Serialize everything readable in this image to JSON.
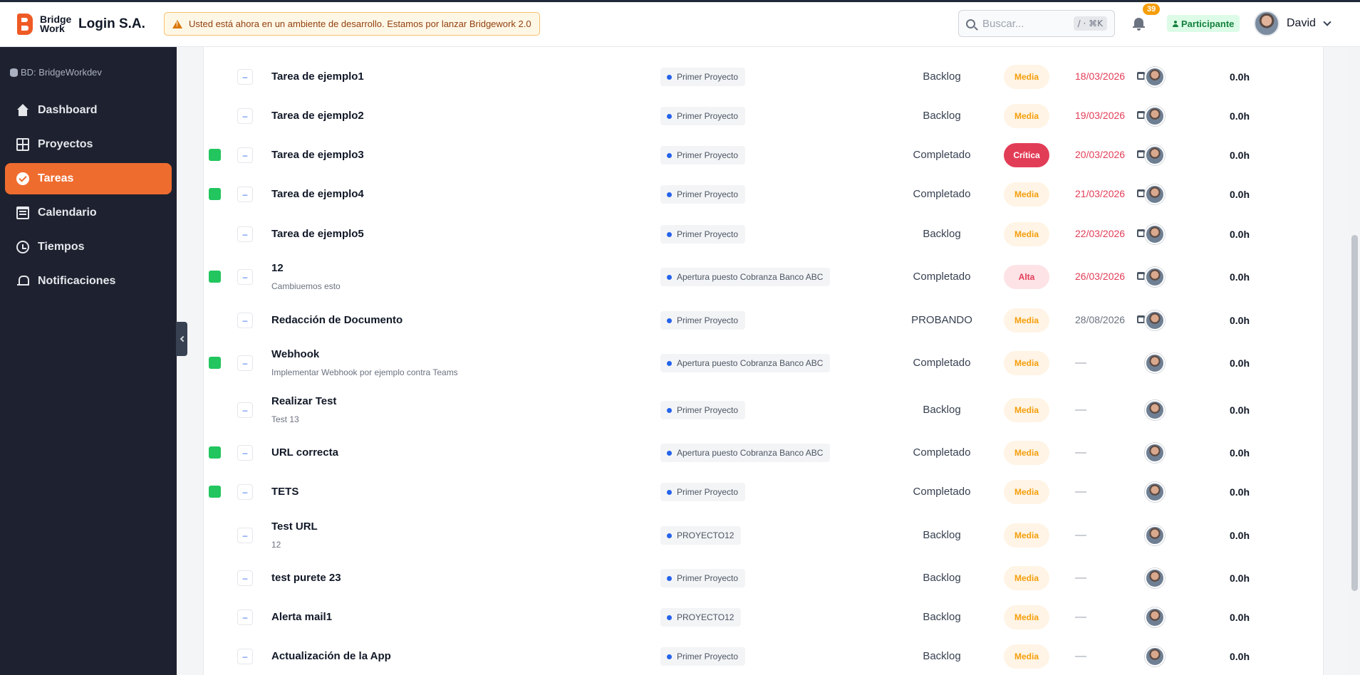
{
  "header": {
    "logo_text": "Bridge Work",
    "company": "Login S.A.",
    "dev_banner": "Usted está ahora en un ambiente de desarrollo. Estamos por lanzar Bridgework 2.0",
    "search_placeholder": "Buscar...",
    "search_shortcut": "/ · ⌘K",
    "notifications_count": "39",
    "role": "Participante",
    "user_name": "David"
  },
  "sidebar": {
    "db_label": "BD: BridgeWorkdev",
    "items": [
      {
        "label": "Dashboard",
        "icon": "home-icon"
      },
      {
        "label": "Proyectos",
        "icon": "grid-icon"
      },
      {
        "label": "Tareas",
        "icon": "check-circle-icon",
        "active": true
      },
      {
        "label": "Calendario",
        "icon": "calendar-icon"
      },
      {
        "label": "Tiempos",
        "icon": "clock-icon"
      },
      {
        "label": "Notificaciones",
        "icon": "bell-icon"
      }
    ]
  },
  "tasks": [
    {
      "title": "Tarea de ejemplo1",
      "subtitle": "",
      "project": "Primer Proyecto",
      "status": "Backlog",
      "priority": "Media",
      "date": "18/03/2026",
      "hours": "0.0h",
      "done": false
    },
    {
      "title": "Tarea de ejemplo2",
      "subtitle": "",
      "project": "Primer Proyecto",
      "status": "Backlog",
      "priority": "Media",
      "date": "19/03/2026",
      "hours": "0.0h",
      "done": false
    },
    {
      "title": "Tarea de ejemplo3",
      "subtitle": "",
      "project": "Primer Proyecto",
      "status": "Completado",
      "priority": "Crítica",
      "date": "20/03/2026",
      "hours": "0.0h",
      "done": true
    },
    {
      "title": "Tarea de ejemplo4",
      "subtitle": "",
      "project": "Primer Proyecto",
      "status": "Completado",
      "priority": "Media",
      "date": "21/03/2026",
      "hours": "0.0h",
      "done": true
    },
    {
      "title": "Tarea de ejemplo5",
      "subtitle": "",
      "project": "Primer Proyecto",
      "status": "Backlog",
      "priority": "Media",
      "date": "22/03/2026",
      "hours": "0.0h",
      "done": false
    },
    {
      "title": "12",
      "subtitle": "Cambiuemos esto",
      "project": "Apertura puesto Cobranza Banco ABC",
      "status": "Completado",
      "priority": "Alta",
      "date": "26/03/2026",
      "hours": "0.0h",
      "done": true
    },
    {
      "title": "Redacción de Documento",
      "subtitle": "",
      "project": "Primer Proyecto",
      "status": "PROBANDO",
      "priority": "Media",
      "date": "28/08/2026",
      "hours": "0.0h",
      "done": false
    },
    {
      "title": "Webhook",
      "subtitle": "Implementar Webhook por ejemplo contra Teams",
      "project": "Apertura puesto Cobranza Banco ABC",
      "status": "Completado",
      "priority": "Media",
      "date": "—",
      "hours": "0.0h",
      "done": true
    },
    {
      "title": "Realizar Test",
      "subtitle": "Test 13",
      "project": "Primer Proyecto",
      "status": "Backlog",
      "priority": "Media",
      "date": "—",
      "hours": "0.0h",
      "done": false
    },
    {
      "title": "URL correcta",
      "subtitle": "",
      "project": "Apertura puesto Cobranza Banco ABC",
      "status": "Completado",
      "priority": "Media",
      "date": "—",
      "hours": "0.0h",
      "done": true
    },
    {
      "title": "TETS",
      "subtitle": "",
      "project": "Primer Proyecto",
      "status": "Completado",
      "priority": "Media",
      "date": "—",
      "hours": "0.0h",
      "done": true
    },
    {
      "title": "Test URL",
      "subtitle": "12",
      "project": "PROYECTO12",
      "status": "Backlog",
      "priority": "Media",
      "date": "—",
      "hours": "0.0h",
      "done": false
    },
    {
      "title": "test purete 23",
      "subtitle": "",
      "project": "Primer Proyecto",
      "status": "Backlog",
      "priority": "Media",
      "date": "—",
      "hours": "0.0h",
      "done": false
    },
    {
      "title": "Alerta mail1",
      "subtitle": "",
      "project": "PROYECTO12",
      "status": "Backlog",
      "priority": "Media",
      "date": "—",
      "hours": "0.0h",
      "done": false
    },
    {
      "title": "Actualización de la App",
      "subtitle": "",
      "project": "Primer Proyecto",
      "status": "Backlog",
      "priority": "Media",
      "date": "—",
      "hours": "0.0h",
      "done": false
    }
  ],
  "colors": {
    "accent": "#ef6c2f",
    "sidebar_bg": "#1e2230",
    "done_green": "#22c55e",
    "date_red": "#e23d57"
  }
}
